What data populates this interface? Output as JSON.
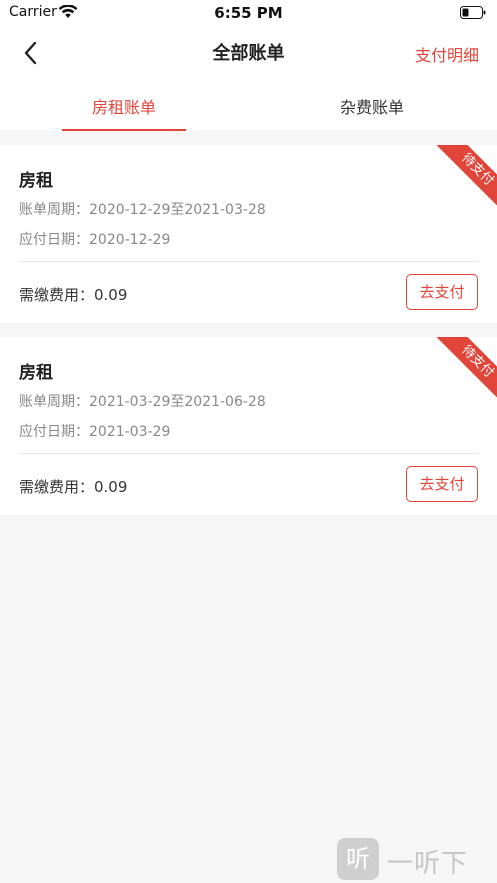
{
  "status_bar": {
    "carrier": "Carrier",
    "time": "6:55 PM",
    "icons": [
      "wifi-icon",
      "battery-icon"
    ]
  },
  "nav": {
    "title": "全部账单",
    "right_link": "支付明细",
    "back_icon": "chevron-left-icon"
  },
  "tabs": [
    {
      "label": "房租账单",
      "active": true
    },
    {
      "label": "杂费账单",
      "active": false
    }
  ],
  "bills": [
    {
      "title": "房租",
      "period": "账单周期：2020-12-29至2021-03-28",
      "due_date": "应付日期：2020-12-29",
      "fee": "需缴费用：0.09",
      "status": "待支付",
      "pay_label": "去支付"
    },
    {
      "title": "房租",
      "period": "账单周期：2021-03-29至2021-06-28",
      "due_date": "应付日期：2021-03-29",
      "fee": "需缴费用：0.09",
      "status": "待支付",
      "pay_label": "去支付"
    }
  ],
  "watermark": {
    "icon_glyph": "听",
    "text": "一听下载"
  },
  "colors": {
    "accent": "#e2463a",
    "background": "#f6f6f7",
    "card": "#ffffff"
  }
}
